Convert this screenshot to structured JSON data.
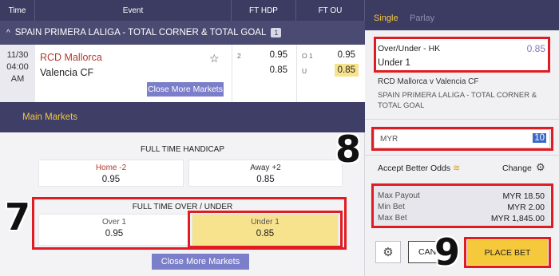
{
  "header": {
    "time": "Time",
    "event": "Event",
    "ft_hdp": "FT HDP",
    "ft_ou": "FT OU"
  },
  "league": {
    "chevron": "^",
    "name": "SPAIN PRIMERA LALIGA - TOTAL CORNER & TOTAL GOAL",
    "count": "1"
  },
  "match": {
    "date": "11/30",
    "time": "04:00",
    "ampm": "AM",
    "home": "RCD Mallorca",
    "away": "Valencia CF",
    "star_icon": "star-outline-icon",
    "close_more": "Close More Markets",
    "hdp": {
      "line": "2",
      "home": "0.95",
      "away": "0.85"
    },
    "ou": {
      "over_label": "O 1",
      "under_label": "U",
      "over": "0.95",
      "under": "0.85"
    }
  },
  "main_markets": "Main Markets",
  "ft_handicap": {
    "title": "FULL TIME HANDICAP",
    "home_label": "Home -2",
    "home_odds": "0.95",
    "away_label": "Away +2",
    "away_odds": "0.85"
  },
  "ft_ou_market": {
    "title": "FULL TIME OVER / UNDER",
    "over_label": "Over 1",
    "over_odds": "0.95",
    "under_label": "Under 1",
    "under_odds": "0.85"
  },
  "close_more_bottom": "Close More Markets",
  "annotations": {
    "seven": "7",
    "eight": "8",
    "nine": "9"
  },
  "betslip": {
    "tab_single": "Single",
    "tab_parlay": "Parlay",
    "bet_type": "Over/Under - HK",
    "odds": "0.85",
    "pick": "Under 1",
    "match": "RCD Mallorca v Valencia CF",
    "league": "SPAIN PRIMERA LALIGA - TOTAL CORNER & TOTAL GOAL",
    "currency": "MYR",
    "stake": "10",
    "accept_better_odds": "Accept Better Odds",
    "coins_icon": "coins-icon",
    "change": "Change",
    "gear_icon": "gear-icon",
    "max_payout_label": "Max Payout",
    "max_payout": "MYR 18.50",
    "min_bet_label": "Min Bet",
    "min_bet": "MYR 2.00",
    "max_bet_label": "Max Bet",
    "max_bet": "MYR 1,845.00",
    "cancel": "CANC",
    "place_bet": "PLACE BET"
  },
  "colors": {
    "header": "#3c3c63",
    "highlight": "#f7e28d",
    "annotation_red": "#e11b22",
    "place_bet": "#f6c83b",
    "accent_gold": "#f0c545"
  }
}
